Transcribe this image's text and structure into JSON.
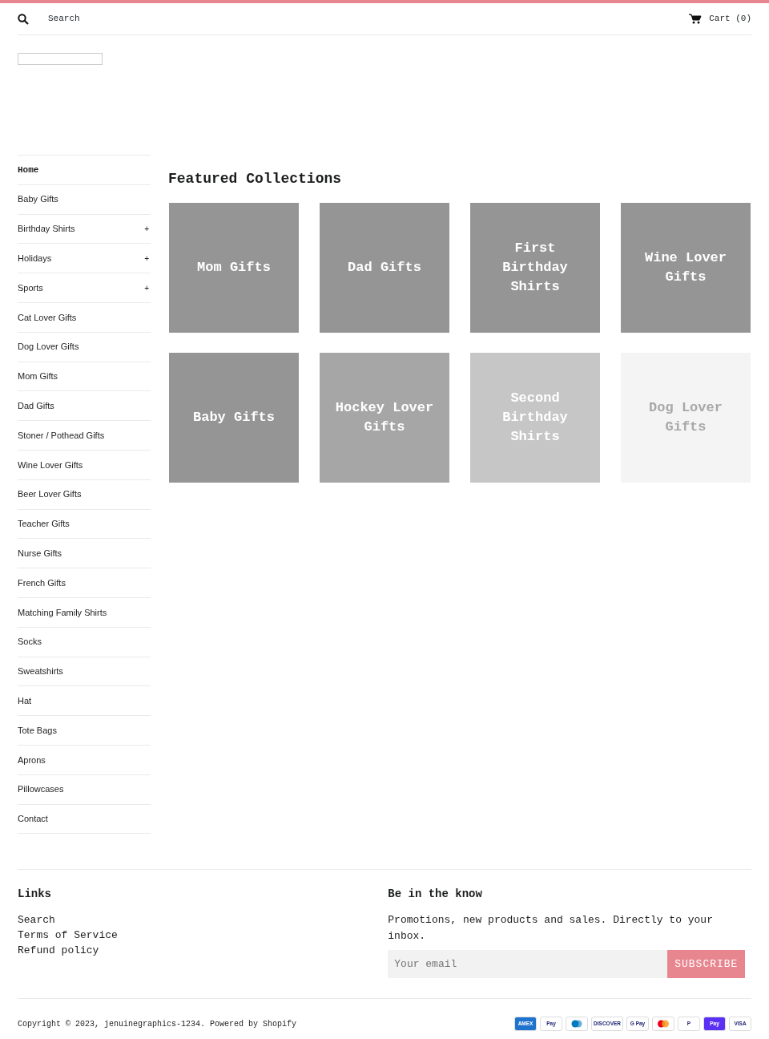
{
  "header": {
    "search_label": "Search",
    "cart": "Cart (0)"
  },
  "sidebar": {
    "items": [
      {
        "label": "Home",
        "selected": true
      },
      {
        "label": "Baby Gifts",
        "selected": false
      },
      {
        "label": "Birthday Shirts",
        "selected": false,
        "toggle": "+"
      },
      {
        "label": "Holidays",
        "selected": false,
        "toggle": "+"
      },
      {
        "label": "Sports",
        "selected": false,
        "toggle": "+"
      },
      {
        "label": "Cat Lover Gifts",
        "selected": false
      },
      {
        "label": "Dog Lover Gifts",
        "selected": false
      },
      {
        "label": "Mom Gifts",
        "selected": false
      },
      {
        "label": "Dad Gifts",
        "selected": false
      },
      {
        "label": "Stoner / Pothead Gifts",
        "selected": false
      },
      {
        "label": "Wine Lover Gifts",
        "selected": false
      },
      {
        "label": "Beer Lover Gifts",
        "selected": false
      },
      {
        "label": "Teacher Gifts",
        "selected": false
      },
      {
        "label": "Nurse Gifts",
        "selected": false
      },
      {
        "label": "French Gifts",
        "selected": false
      },
      {
        "label": "Matching Family Shirts",
        "selected": false
      },
      {
        "label": "Socks",
        "selected": false
      },
      {
        "label": "Sweatshirts",
        "selected": false
      },
      {
        "label": "Hat",
        "selected": false
      },
      {
        "label": "Tote Bags",
        "selected": false
      },
      {
        "label": "Aprons",
        "selected": false
      },
      {
        "label": "Pillowcases",
        "selected": false
      },
      {
        "label": "Contact",
        "selected": false
      }
    ]
  },
  "featured": {
    "title": "Featured Collections",
    "collections": [
      {
        "title": "Mom Gifts",
        "color": "#959595"
      },
      {
        "title": "Dad Gifts",
        "color": "#959595"
      },
      {
        "title": "First Birthday Shirts",
        "color": "#959595"
      },
      {
        "title": "Wine Lover Gifts",
        "color": "#959595"
      },
      {
        "title": "Baby Gifts",
        "color": "#959595"
      },
      {
        "title": "Hockey Lover Gifts",
        "color": "#a6a6a6"
      },
      {
        "title": "Second Birthday Shirts",
        "color": "#c6c6c6"
      },
      {
        "title": "Dog Lover Gifts",
        "color": "#f4f4f4"
      }
    ]
  },
  "footer": {
    "links_title": "Links",
    "links": [
      "Search",
      "Terms of Service",
      "Refund policy"
    ],
    "newsletter_title": "Be in the know",
    "newsletter_text": "Promotions, new products and sales. Directly to your inbox.",
    "email": {
      "placeholder": "Your email"
    },
    "subscribe": "SUBSCRIBE",
    "copyright": "Copyright © 2023, jenuinegraphics-1234. Powered by Shopify",
    "payments": [
      {
        "kind": "text",
        "label": "AMEX",
        "color": "#1f72cd"
      },
      {
        "kind": "text",
        "label": "Pay",
        "color": "#ffffff"
      },
      {
        "kind": "diners",
        "color": "#ffffff"
      },
      {
        "kind": "text",
        "label": "DISCOVER",
        "color": "#ffffff"
      },
      {
        "kind": "text",
        "label": "G Pay",
        "color": "#ffffff"
      },
      {
        "kind": "circles",
        "color": "#ffffff"
      },
      {
        "kind": "text",
        "label": "P",
        "color": "#ffffff"
      },
      {
        "kind": "text",
        "label": "Pay",
        "color": "#5a31f4"
      },
      {
        "kind": "text",
        "label": "VISA",
        "color": "#ffffff"
      }
    ]
  }
}
